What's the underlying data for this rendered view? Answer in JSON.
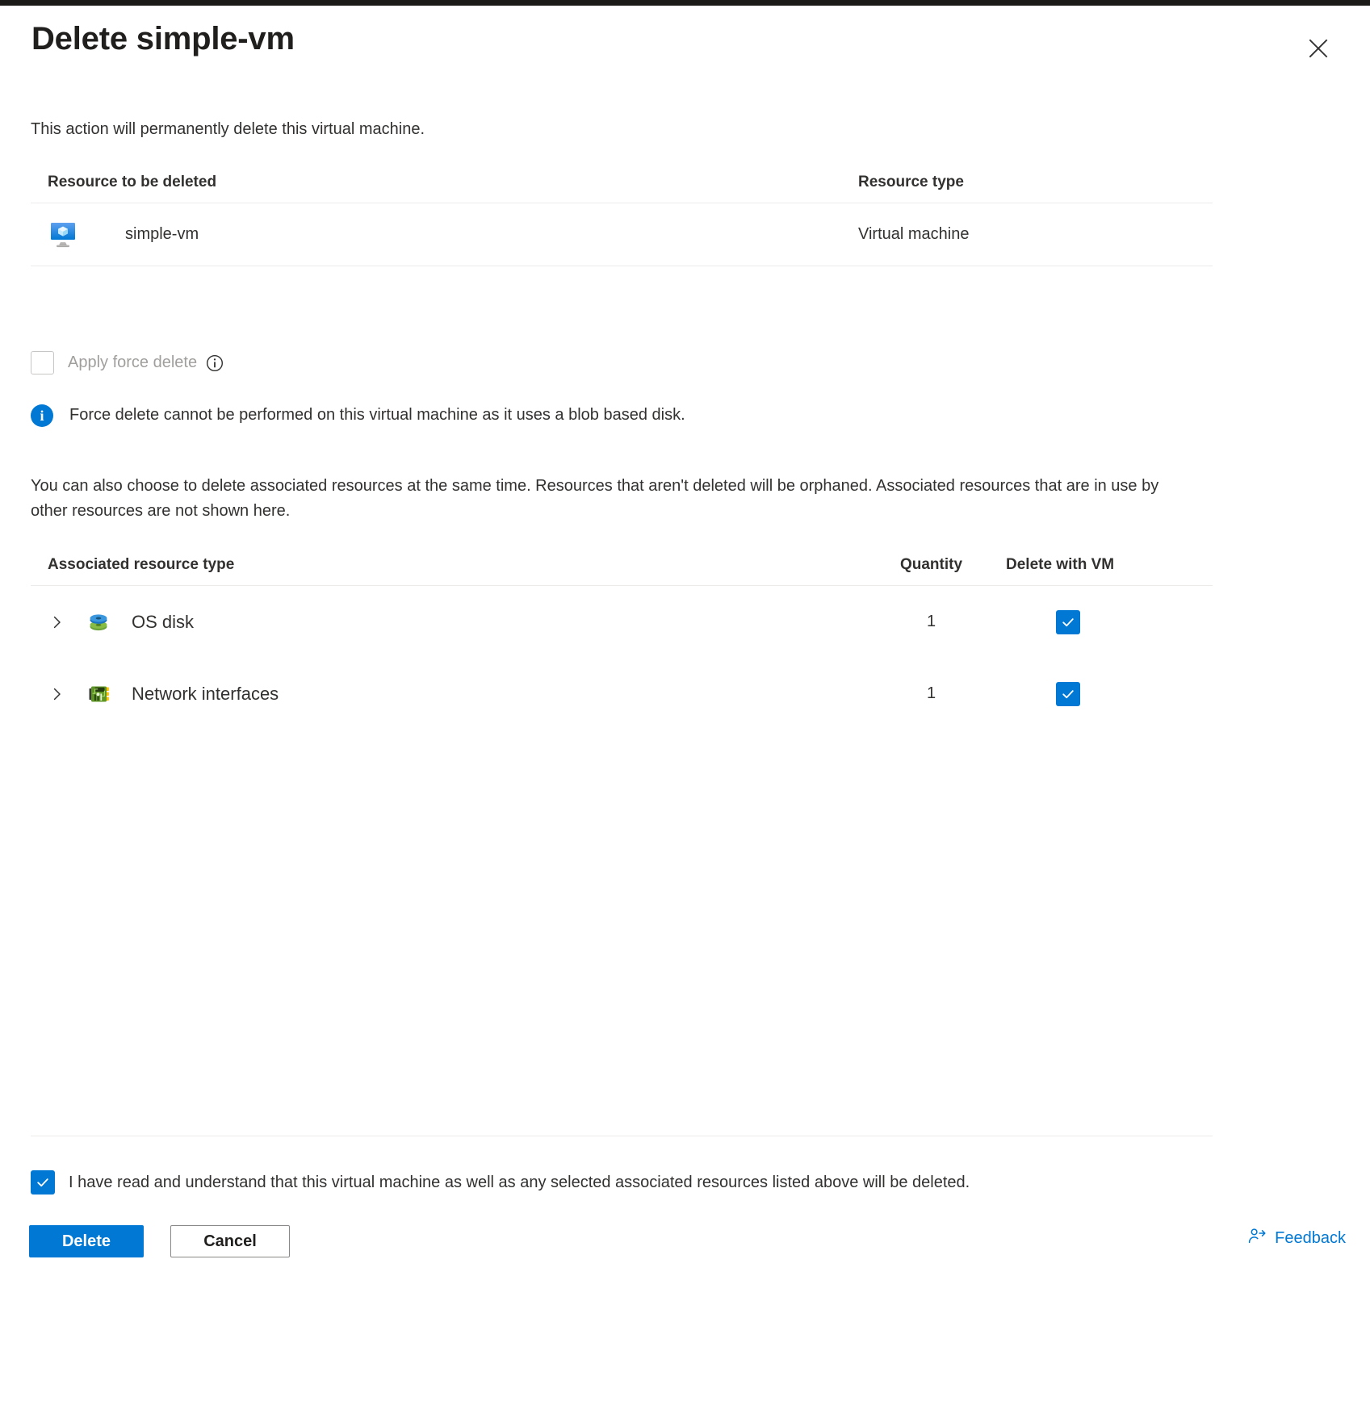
{
  "header": {
    "title": "Delete simple-vm",
    "close_icon": "close-icon"
  },
  "intro": {
    "text": "This action will permanently delete this virtual machine."
  },
  "resource_table": {
    "columns": [
      "Resource to be deleted",
      "Resource type"
    ],
    "rows": [
      {
        "icon": "virtual-machine-icon",
        "name": "simple-vm",
        "type": "Virtual machine"
      }
    ]
  },
  "force_delete": {
    "label": "Apply force delete",
    "checked": false,
    "disabled": true,
    "info_icon": "info-circle-outline-icon",
    "message": "Force delete cannot be performed on this virtual machine as it uses a blob based disk.",
    "message_icon": "info-filled-icon"
  },
  "description": {
    "text": "You can also choose to delete associated resources at the same time. Resources that aren't deleted will be orphaned. Associated resources that are in use by other resources are not shown here."
  },
  "associated_table": {
    "columns": [
      "Associated resource type",
      "Quantity",
      "Delete with VM"
    ],
    "rows": [
      {
        "expand_icon": "chevron-right-icon",
        "icon": "disk-icon",
        "name": "OS disk",
        "quantity": "1",
        "delete_with_vm": true
      },
      {
        "expand_icon": "chevron-right-icon",
        "icon": "network-interface-icon",
        "name": "Network interfaces",
        "quantity": "1",
        "delete_with_vm": true
      }
    ]
  },
  "consent": {
    "checked": true,
    "text": "I have read and understand that this virtual machine as well as any selected associated resources listed above will be deleted."
  },
  "actions": {
    "delete_label": "Delete",
    "cancel_label": "Cancel"
  },
  "feedback": {
    "label": "Feedback",
    "icon": "feedback-person-icon"
  },
  "colors": {
    "accent": "#0078D4",
    "text": "#323130",
    "disabled_text": "#A19F9D",
    "border": "#EDEBE9"
  }
}
